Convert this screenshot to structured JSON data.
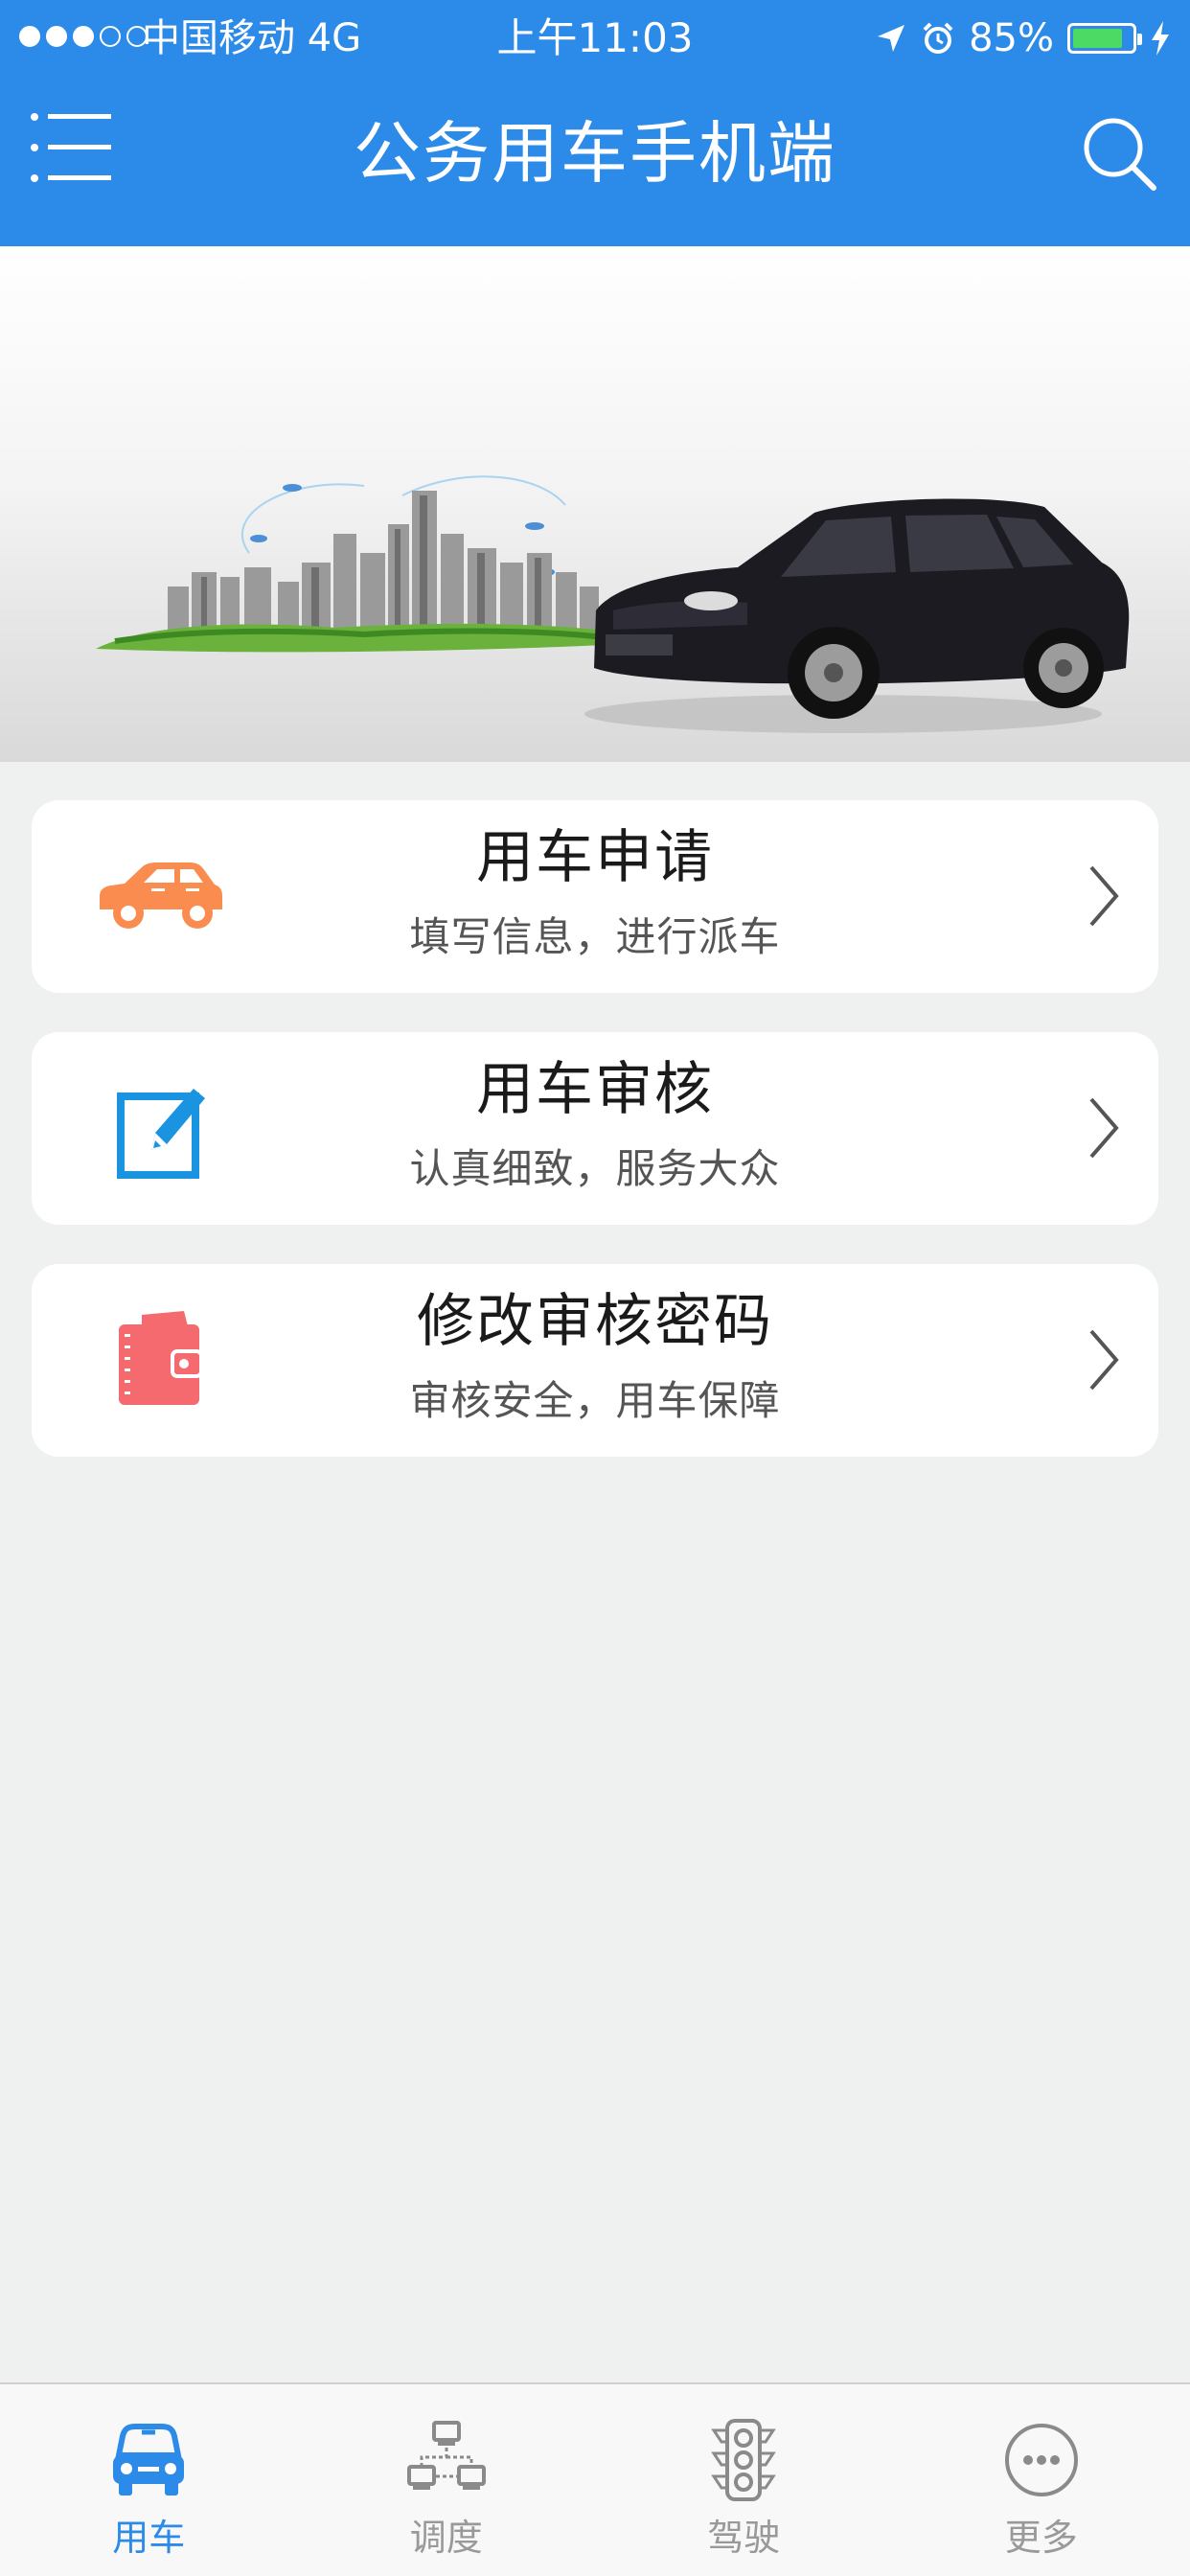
{
  "status_bar": {
    "carrier": "中国移动   4G",
    "time": "上午11:03",
    "battery_text": "85%",
    "battery_level": 0.85,
    "signal_strength": 3,
    "signal_max": 5
  },
  "nav": {
    "title": "公务用车手机端",
    "menu_icon": "menu-icon",
    "search_icon": "search-icon"
  },
  "banner": {
    "image": "city-skyline-and-black-sedan"
  },
  "cards": [
    {
      "title": "用车申请",
      "subtitle": "填写信息，进行派车",
      "icon": "car-icon",
      "icon_color": "#f98c4e"
    },
    {
      "title": "用车审核",
      "subtitle": "认真细致，服务大众",
      "icon": "edit-icon",
      "icon_color": "#1a93e0"
    },
    {
      "title": "修改审核密码",
      "subtitle": "审核安全，用车保障",
      "icon": "wallet-icon",
      "icon_color": "#f46a6f"
    }
  ],
  "tabs": [
    {
      "label": "用车",
      "icon": "car-front-icon",
      "active": true
    },
    {
      "label": "调度",
      "icon": "network-icon",
      "active": false
    },
    {
      "label": "驾驶",
      "icon": "traffic-light-icon",
      "active": false
    },
    {
      "label": "更多",
      "icon": "more-icon",
      "active": false
    }
  ],
  "colors": {
    "primary": "#2c8be8",
    "background": "#eff0f0",
    "tab_inactive": "#999999"
  }
}
